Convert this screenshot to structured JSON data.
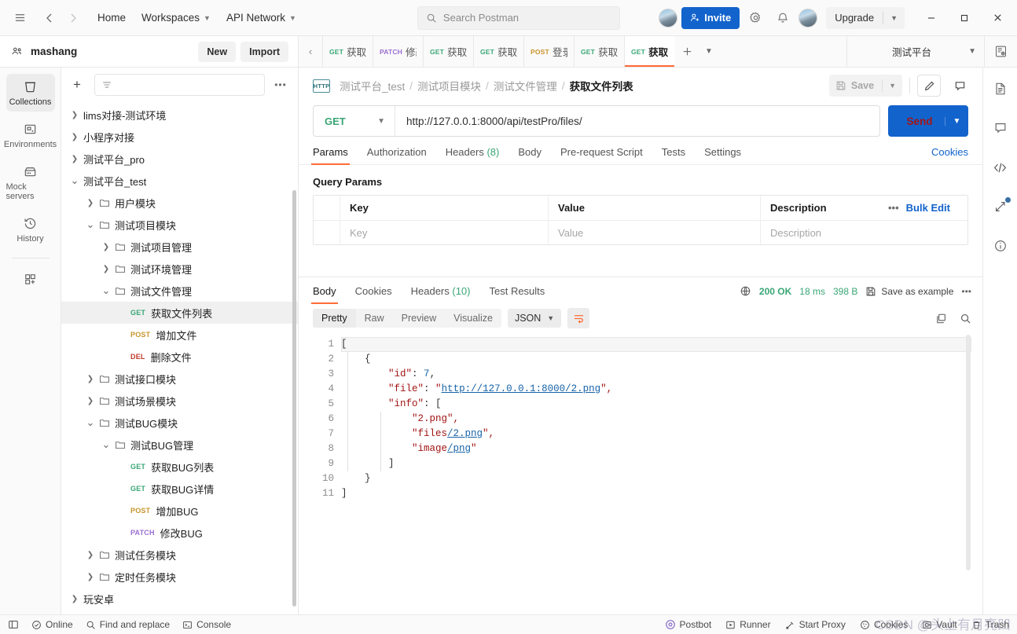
{
  "topbar": {
    "hamburger": "menu-icon",
    "back": "back-arrow",
    "forward": "forward-arrow",
    "home": "Home",
    "workspaces": "Workspaces",
    "api_network": "API Network",
    "search_placeholder": "Search Postman",
    "invite": "Invite",
    "upgrade": "Upgrade"
  },
  "workspace": {
    "name": "mashang",
    "new_label": "New",
    "import_label": "Import"
  },
  "tabs": {
    "items": [
      {
        "method": "GET",
        "label": "获取B",
        "active": false
      },
      {
        "method": "PATCH",
        "label": "修改",
        "active": false
      },
      {
        "method": "GET",
        "label": "获取B",
        "active": false
      },
      {
        "method": "GET",
        "label": "获取项",
        "active": false
      },
      {
        "method": "POST",
        "label": "登录",
        "active": false
      },
      {
        "method": "GET",
        "label": "获取文",
        "active": false
      },
      {
        "method": "GET",
        "label": "获取文",
        "active": true
      }
    ],
    "environment": "测试平台"
  },
  "rail": {
    "items": [
      {
        "label": "Collections",
        "icon": "collections-icon",
        "active": true
      },
      {
        "label": "Environments",
        "icon": "environments-icon",
        "active": false
      },
      {
        "label": "Mock servers",
        "icon": "mock-servers-icon",
        "active": false
      },
      {
        "label": "History",
        "icon": "history-icon",
        "active": false
      }
    ],
    "more_icon": "add-apps-icon"
  },
  "collections": {
    "filter_placeholder": "",
    "tree": [
      {
        "depth": 0,
        "twisty": "right",
        "type": "collection",
        "label": "lims对接-测试环境"
      },
      {
        "depth": 0,
        "twisty": "right",
        "type": "collection",
        "label": "小程序对接"
      },
      {
        "depth": 0,
        "twisty": "right",
        "type": "collection",
        "label": "测试平台_pro"
      },
      {
        "depth": 0,
        "twisty": "down",
        "type": "collection",
        "label": "测试平台_test"
      },
      {
        "depth": 1,
        "twisty": "right",
        "type": "folder",
        "label": "用户模块"
      },
      {
        "depth": 1,
        "twisty": "down",
        "type": "folder",
        "label": "测试项目模块"
      },
      {
        "depth": 2,
        "twisty": "right",
        "type": "folder",
        "label": "测试项目管理"
      },
      {
        "depth": 2,
        "twisty": "right",
        "type": "folder",
        "label": "测试环境管理"
      },
      {
        "depth": 2,
        "twisty": "down",
        "type": "folder",
        "label": "测试文件管理"
      },
      {
        "depth": 3,
        "twisty": "none",
        "type": "request",
        "method": "GET",
        "label": "获取文件列表",
        "selected": true
      },
      {
        "depth": 3,
        "twisty": "none",
        "type": "request",
        "method": "POST",
        "label": "增加文件"
      },
      {
        "depth": 3,
        "twisty": "none",
        "type": "request",
        "method": "DEL",
        "label": "删除文件"
      },
      {
        "depth": 1,
        "twisty": "right",
        "type": "folder",
        "label": "测试接口模块"
      },
      {
        "depth": 1,
        "twisty": "right",
        "type": "folder",
        "label": "测试场景模块"
      },
      {
        "depth": 1,
        "twisty": "down",
        "type": "folder",
        "label": "测试BUG模块"
      },
      {
        "depth": 2,
        "twisty": "down",
        "type": "folder",
        "label": "测试BUG管理"
      },
      {
        "depth": 3,
        "twisty": "none",
        "type": "request",
        "method": "GET",
        "label": "获取BUG列表"
      },
      {
        "depth": 3,
        "twisty": "none",
        "type": "request",
        "method": "GET",
        "label": "获取BUG详情"
      },
      {
        "depth": 3,
        "twisty": "none",
        "type": "request",
        "method": "POST",
        "label": "增加BUG"
      },
      {
        "depth": 3,
        "twisty": "none",
        "type": "request",
        "method": "PATCH",
        "label": "修改BUG"
      },
      {
        "depth": 1,
        "twisty": "right",
        "type": "folder",
        "label": "测试任务模块"
      },
      {
        "depth": 1,
        "twisty": "right",
        "type": "folder",
        "label": "定时任务模块"
      },
      {
        "depth": 0,
        "twisty": "right",
        "type": "collection",
        "label": "玩安卓"
      }
    ]
  },
  "request": {
    "breadcrumb": [
      "测试平台_test",
      "测试项目模块",
      "测试文件管理"
    ],
    "breadcrumb_current": "获取文件列表",
    "protocol_badge": "HTTP",
    "save_label": "Save",
    "method": "GET",
    "url": "http://127.0.0.1:8000/api/testPro/files/",
    "send_label": "Send",
    "tabs": [
      {
        "label": "Params",
        "active": true
      },
      {
        "label": "Authorization",
        "active": false
      },
      {
        "label": "Headers",
        "count": "(8)",
        "active": false
      },
      {
        "label": "Body",
        "active": false
      },
      {
        "label": "Pre-request Script",
        "active": false
      },
      {
        "label": "Tests",
        "active": false
      },
      {
        "label": "Settings",
        "active": false
      }
    ],
    "cookies_link": "Cookies",
    "query_params": {
      "title": "Query Params",
      "headers": [
        "Key",
        "Value",
        "Description"
      ],
      "bulk_edit": "Bulk Edit",
      "placeholder_row": [
        "Key",
        "Value",
        "Description"
      ]
    }
  },
  "response": {
    "tabs": [
      {
        "label": "Body",
        "active": true
      },
      {
        "label": "Cookies",
        "active": false
      },
      {
        "label": "Headers",
        "count": "(10)",
        "active": false
      },
      {
        "label": "Test Results",
        "active": false
      }
    ],
    "status": "200 OK",
    "time": "18 ms",
    "size": "398 B",
    "save_as_example": "Save as example",
    "view_tabs": [
      {
        "label": "Pretty",
        "active": true
      },
      {
        "label": "Raw",
        "active": false
      },
      {
        "label": "Preview",
        "active": false
      },
      {
        "label": "Visualize",
        "active": false
      }
    ],
    "format": "JSON",
    "body_lines": [
      {
        "n": "1",
        "segs": [
          {
            "t": "[",
            "c": "p"
          }
        ]
      },
      {
        "n": "2",
        "segs": [
          {
            "t": "    {",
            "c": "p"
          }
        ]
      },
      {
        "n": "3",
        "segs": [
          {
            "t": "        ",
            "c": "p"
          },
          {
            "t": "\"id\"",
            "c": "k"
          },
          {
            "t": ": ",
            "c": "p"
          },
          {
            "t": "7",
            "c": "n"
          },
          {
            "t": ",",
            "c": "p"
          }
        ]
      },
      {
        "n": "4",
        "segs": [
          {
            "t": "        ",
            "c": "p"
          },
          {
            "t": "\"file\"",
            "c": "k"
          },
          {
            "t": ": ",
            "c": "p"
          },
          {
            "t": "\"",
            "c": "s"
          },
          {
            "t": "http://127.0.0.1:8000/2.png",
            "c": "lnk"
          },
          {
            "t": "\",",
            "c": "s"
          }
        ]
      },
      {
        "n": "5",
        "segs": [
          {
            "t": "        ",
            "c": "p"
          },
          {
            "t": "\"info\"",
            "c": "k"
          },
          {
            "t": ": [",
            "c": "p"
          }
        ]
      },
      {
        "n": "6",
        "segs": [
          {
            "t": "            ",
            "c": "p"
          },
          {
            "t": "\"2.png\",",
            "c": "s"
          }
        ]
      },
      {
        "n": "7",
        "segs": [
          {
            "t": "            ",
            "c": "p"
          },
          {
            "t": "\"files",
            "c": "s"
          },
          {
            "t": "/2.png",
            "c": "lnk"
          },
          {
            "t": "\",",
            "c": "s"
          }
        ]
      },
      {
        "n": "8",
        "segs": [
          {
            "t": "            ",
            "c": "p"
          },
          {
            "t": "\"image",
            "c": "s"
          },
          {
            "t": "/png",
            "c": "lnk"
          },
          {
            "t": "\"",
            "c": "s"
          }
        ]
      },
      {
        "n": "9",
        "segs": [
          {
            "t": "        ]",
            "c": "p"
          }
        ]
      },
      {
        "n": "10",
        "segs": [
          {
            "t": "    }",
            "c": "p"
          }
        ]
      },
      {
        "n": "11",
        "segs": [
          {
            "t": "]",
            "c": "p"
          }
        ]
      }
    ]
  },
  "right_rail": {
    "items": [
      "documentation-icon",
      "comments-icon",
      "code-icon",
      "share-icon",
      "info-icon"
    ]
  },
  "status_bar": {
    "left": [
      {
        "label": "",
        "icon": "sidebar-toggle-icon"
      },
      {
        "label": "Online",
        "icon": "online-icon"
      },
      {
        "label": "Find and replace",
        "icon": "search-icon"
      },
      {
        "label": "Console",
        "icon": "console-icon"
      }
    ],
    "right": [
      {
        "label": "Postbot",
        "icon": "postbot-icon"
      },
      {
        "label": "Runner",
        "icon": "runner-icon"
      },
      {
        "label": "Start Proxy",
        "icon": "proxy-icon"
      },
      {
        "label": "Cookies",
        "icon": "cookies-icon"
      },
      {
        "label": "Vault",
        "icon": "vault-icon"
      },
      {
        "label": "Trash",
        "icon": "trash-icon"
      }
    ]
  },
  "watermark": "CSDN @头上有月亮凹",
  "colors": {
    "accent": "#ff6c37",
    "primary": "#1263cc",
    "get": "#3aa675",
    "post": "#c7952a",
    "patch": "#9b6fd1",
    "del": "#c0392b"
  }
}
